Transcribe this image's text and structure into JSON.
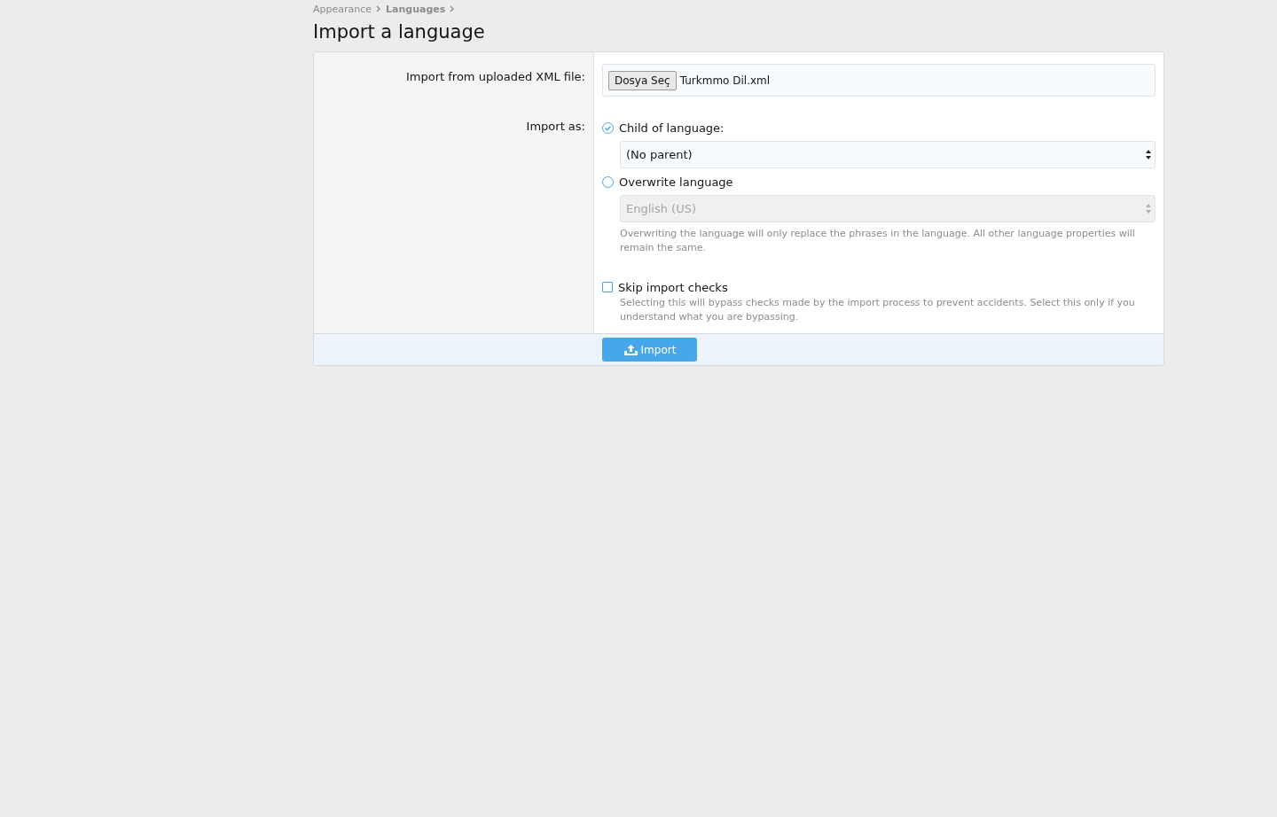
{
  "breadcrumb": [
    {
      "label": "Appearance",
      "current": false
    },
    {
      "label": "Languages",
      "current": true
    }
  ],
  "title": "Import a language",
  "file_row": {
    "label": "Import from uploaded XML file:",
    "button": "Dosya Seç",
    "file_name": "Turkmmo Dil.xml"
  },
  "import_as": {
    "label": "Import as:",
    "options": [
      {
        "label": "Child of language:",
        "selected": true,
        "select": {
          "value": "(No parent)",
          "disabled": false
        }
      },
      {
        "label": "Overwrite language",
        "selected": false,
        "select": {
          "value": "English (US)",
          "disabled": true
        },
        "hint": "Overwriting the language will only replace the phrases in the language. All other language properties will remain the same."
      }
    ]
  },
  "skip_checks": {
    "label": "Skip import checks",
    "checked": false,
    "hint": "Selecting this will bypass checks made by the import process to prevent accidents. Select this only if you understand what you are bypassing."
  },
  "submit": "Import"
}
